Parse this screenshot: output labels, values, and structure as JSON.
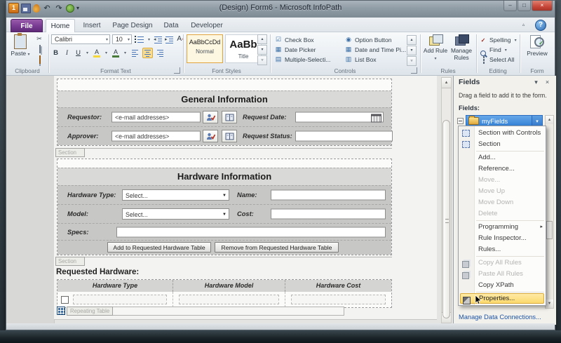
{
  "window": {
    "title": "(Design) Form6 - Microsoft InfoPath",
    "minimize": "–",
    "maximize": "□",
    "close": "×"
  },
  "qat": {
    "app_label": "1"
  },
  "icons": {
    "dropdown": "▾",
    "up_arrow": "▴",
    "down_arrow": "▾",
    "more_arrow": "▿",
    "submenu_arrow": "▸",
    "close_pane": "×",
    "help": "?",
    "undo": "↶",
    "redo": "↷",
    "select_arrow": "▼",
    "check": "✓",
    "check_box_glyph": "☑",
    "option_glyph": "◉",
    "date_glyph": "▦",
    "multi_list_glyph": "▤",
    "list_box_glyph": "▥",
    "ribbon_collapse": "▵",
    "cut_glyph": "✂",
    "spelling_glyph": "ab"
  },
  "ribbon": {
    "file_tab": "File",
    "tabs": [
      {
        "label": "Home",
        "active": true
      },
      {
        "label": "Insert"
      },
      {
        "label": "Page Design"
      },
      {
        "label": "Data"
      },
      {
        "label": "Developer"
      }
    ],
    "clipboard": {
      "label": "Clipboard",
      "paste": "Paste"
    },
    "format_text": {
      "label": "Format Text",
      "font_name": "Calibri",
      "font_size": "10",
      "bold": "B",
      "italic": "I",
      "underline": "U",
      "highlight": "A",
      "font_color": "A"
    },
    "font_styles": {
      "label": "Font Styles",
      "styles": [
        {
          "sample": "AaBbCcDd",
          "name": "Normal",
          "selected": true
        },
        {
          "sample": "AaBb",
          "name": "Title"
        }
      ]
    },
    "controls_group": {
      "label": "Controls",
      "items": [
        "Check Box",
        "Date Picker",
        "Multiple-Selecti...",
        "Option Button",
        "Date and Time Pi...",
        "List Box"
      ]
    },
    "rules_group": {
      "label": "Rules",
      "add_rule": "Add Rule",
      "manage_rules": "Manage Rules"
    },
    "editing_group": {
      "label": "Editing",
      "spelling": "Spelling",
      "find": "Find",
      "select_all": "Select All"
    },
    "form_group": {
      "label": "Form",
      "preview": "Preview"
    }
  },
  "form": {
    "general": {
      "title": "General Information",
      "requestor_label": "Requestor:",
      "approver_label": "Approver:",
      "email_value": "<e-mail addresses>",
      "request_date_label": "Request Date:",
      "request_status_label": "Request Status:",
      "section_tab": "Section"
    },
    "hardware": {
      "title": "Hardware Information",
      "type_label": "Hardware Type:",
      "name_label": "Name:",
      "model_label": "Model:",
      "cost_label": "Cost:",
      "specs_label": "Specs:",
      "select_value": "Select...",
      "add_button": "Add to Requested Hardware Table",
      "remove_button": "Remove from Requested Hardware Table",
      "section_tab": "Section"
    },
    "requested": {
      "title": "Requested Hardware:",
      "columns": [
        "Hardware Type",
        "Hardware Model",
        "Hardware Cost"
      ],
      "repeating_tab": "Repeating Table"
    }
  },
  "fields_pane": {
    "title": "Fields",
    "hint": "Drag a field to add it to the form.",
    "fields_label": "Fields:",
    "root_field": "myFields",
    "menu": {
      "items": [
        {
          "label": "Section with Controls"
        },
        {
          "label": "Section"
        },
        {
          "label": "Add..."
        },
        {
          "label": "Reference..."
        },
        {
          "label": "Move...",
          "disabled": true
        },
        {
          "label": "Move Up",
          "disabled": true
        },
        {
          "label": "Move Down",
          "disabled": true
        },
        {
          "label": "Delete",
          "disabled": true
        },
        {
          "label": "Programming",
          "submenu": true
        },
        {
          "label": "Rule Inspector..."
        },
        {
          "label": "Rules..."
        },
        {
          "label": "Copy All Rules",
          "disabled": true
        },
        {
          "label": "Paste All Rules",
          "disabled": true
        },
        {
          "label": "Copy XPath"
        },
        {
          "label": "Properties...",
          "highlighted": true
        }
      ]
    },
    "manage_link": "Manage Data Connections..."
  },
  "colors": {
    "file_tab_purple": "#7a3d94",
    "selection_blue": "#3381d6",
    "menu_highlight_yellow": "#fbd96d",
    "close_button_red": "#c8473a",
    "style_selected_orange": "#e0a33e"
  }
}
